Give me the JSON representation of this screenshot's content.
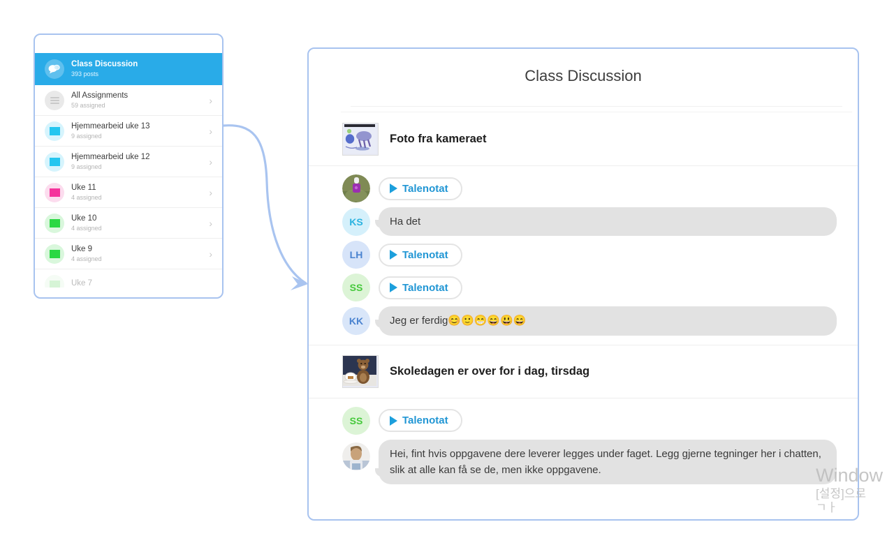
{
  "sidebar": {
    "items": [
      {
        "title": "Class Discussion",
        "subtitle": "393 posts",
        "icon": "chat-bubbles-icon",
        "active": true,
        "chevron": "",
        "icon_color": "#ffffff"
      },
      {
        "title": "All Assignments",
        "subtitle": "59 assigned",
        "icon": "hamburger-list-icon",
        "active": false,
        "chevron": "›",
        "icon_color": "#c9c9c9"
      },
      {
        "title": "Hjemmearbeid uke 13",
        "subtitle": "9 assigned",
        "icon": "folder-icon",
        "active": false,
        "chevron": "›",
        "icon_color": "#24c6f0"
      },
      {
        "title": "Hjemmearbeid uke 12",
        "subtitle": "9 assigned",
        "icon": "folder-icon",
        "active": false,
        "chevron": "›",
        "icon_color": "#24c6f0"
      },
      {
        "title": "Uke 11",
        "subtitle": "4 assigned",
        "icon": "folder-icon",
        "active": false,
        "chevron": "›",
        "icon_color": "#f5339c"
      },
      {
        "title": "Uke 10",
        "subtitle": "4 assigned",
        "icon": "folder-icon",
        "active": false,
        "chevron": "›",
        "icon_color": "#2ad843"
      },
      {
        "title": "Uke 9",
        "subtitle": "4 assigned",
        "icon": "folder-icon",
        "active": false,
        "chevron": "›",
        "icon_color": "#2ad843"
      },
      {
        "title": "Uke 7",
        "subtitle": "",
        "icon": "folder-icon",
        "active": false,
        "chevron": "",
        "icon_color": "#8de08d"
      }
    ]
  },
  "main": {
    "title": "Class Discussion",
    "posts": [
      {
        "title": "Foto fra kameraet",
        "thumb": "child-drawing-thumbnail",
        "messages": [
          {
            "avatar_type": "photo",
            "avatar_initials": "",
            "kind": "voice",
            "text": "Talenotat"
          },
          {
            "avatar_type": "initials",
            "avatar_initials": "KS",
            "kind": "text",
            "text": "Ha det"
          },
          {
            "avatar_type": "initials",
            "avatar_initials": "LH",
            "kind": "voice",
            "text": "Talenotat"
          },
          {
            "avatar_type": "initials",
            "avatar_initials": "SS",
            "kind": "voice",
            "text": "Talenotat"
          },
          {
            "avatar_type": "initials",
            "avatar_initials": "KK",
            "kind": "text",
            "text": "Jeg er ferdig😊🙂😁😄😃😄"
          }
        ]
      },
      {
        "title": "Skoledagen er over for i dag, tirsdag",
        "thumb": "teddy-bear-thumbnail",
        "messages": [
          {
            "avatar_type": "initials",
            "avatar_initials": "SS",
            "kind": "voice",
            "text": "Talenotat"
          },
          {
            "avatar_type": "photo",
            "avatar_initials": "",
            "kind": "text",
            "text": "Hei, fint hvis oppgavene dere leverer legges under faget. Legg gjerne tegninger her i chatten, slik at alle kan få se de, men ikke oppgavene."
          }
        ]
      }
    ]
  },
  "watermark": {
    "line1": "Window",
    "line2": "[설정]으로",
    "line3": "ㄱㅏ"
  },
  "colors": {
    "accent_blue": "#29abe8",
    "card_border": "#a8c3ef",
    "bubble_gray": "#e2e2e2",
    "voice_blue": "#2196d4"
  }
}
